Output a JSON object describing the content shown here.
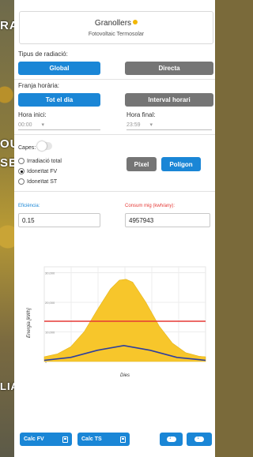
{
  "header": {
    "title": "Granollers",
    "subtitle": "Fotovoltaic Termosolar"
  },
  "map_overlay": [
    "RA",
    "OU",
    "SE",
    "LIA"
  ],
  "radiation": {
    "label": "Tipus de radiació:",
    "options": [
      "Global",
      "Directa"
    ],
    "selected": "Global"
  },
  "time_range": {
    "label": "Franja horària:",
    "options": [
      "Tot el dia",
      "Interval horari"
    ],
    "selected": "Tot el dia",
    "start_label": "Hora inici:",
    "start_value": "00:00",
    "end_label": "Hora final:",
    "end_value": "23:59"
  },
  "layers": {
    "label": "Capes:",
    "items": [
      "Irradiació total",
      "Idoneïtat FV",
      "Idoneïtat ST"
    ],
    "selected": "Idoneïtat FV",
    "mode_options": [
      "Píxel",
      "Polígon"
    ],
    "mode_selected": "Polígon"
  },
  "efficiency": {
    "label": "Eficiència:",
    "value": "0.15",
    "color": "#1a86d6"
  },
  "consumption": {
    "label": "Consum mig (kwh/any):",
    "value": "4957943",
    "color": "#e53935"
  },
  "chart_data": {
    "type": "area",
    "ylabel": "Energia [kWh]",
    "xlabel": "Dies",
    "y_ticks": [
      "30,000",
      "20,000",
      "10,000",
      "0"
    ],
    "ylim": [
      0,
      32000
    ],
    "xlim": [
      0,
      365
    ],
    "grid": true,
    "series": [
      {
        "values": [
          [
            0,
            1600
          ],
          [
            30,
            2600
          ],
          [
            60,
            5000
          ],
          [
            90,
            10000
          ],
          [
            120,
            17500
          ],
          [
            150,
            24500
          ],
          [
            170,
            27500
          ],
          [
            185,
            27800
          ],
          [
            200,
            26800
          ],
          [
            230,
            20000
          ],
          [
            260,
            12000
          ],
          [
            290,
            6200
          ],
          [
            320,
            3000
          ],
          [
            350,
            1800
          ],
          [
            365,
            1600
          ]
        ],
        "color": "#f7c62b"
      },
      {
        "values": [
          [
            0,
            400
          ],
          [
            60,
            1400
          ],
          [
            120,
            3800
          ],
          [
            180,
            5400
          ],
          [
            240,
            3800
          ],
          [
            300,
            1400
          ],
          [
            365,
            400
          ]
        ],
        "color": "#2e3f9e"
      },
      {
        "values": [
          [
            0,
            13600
          ],
          [
            365,
            13600
          ]
        ],
        "color": "#e53935"
      }
    ]
  },
  "footer": {
    "calc_fv": "Calc FV",
    "calc_ts": "Calc TS",
    "download_icons": [
      "cloud-download-icon",
      "cloud-download-icon"
    ]
  }
}
